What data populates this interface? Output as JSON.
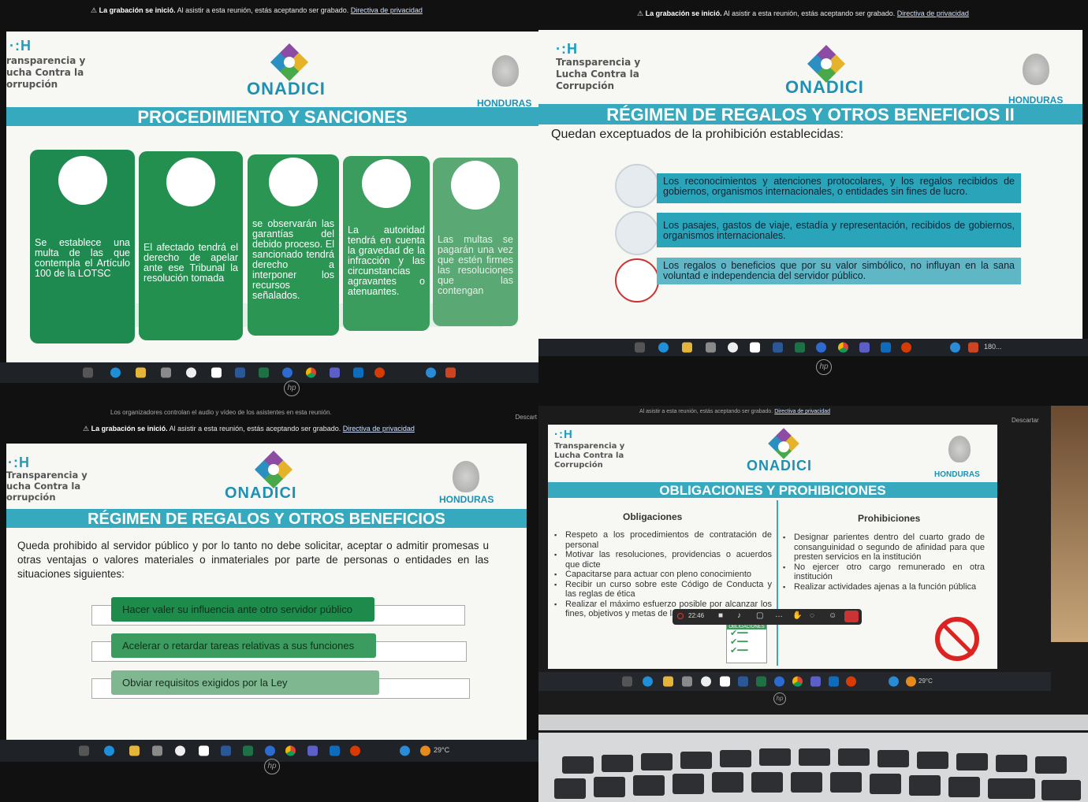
{
  "q1": {
    "banner_bold": "La grabación se inició.",
    "banner_text": "Al asistir a esta reunión, estás aceptando ser grabado.",
    "banner_link": "Directiva de privacidad",
    "org_lines": [
      "ransparencia y",
      "ucha Contra la",
      "orrupción"
    ],
    "brand": "ONADICI",
    "country": "HONDURAS",
    "title": "PROCEDIMIENTO Y SANCIONES",
    "cards": [
      "Se establece una multa de las que contempla el Artículo 100 de la LOTSC",
      "El afectado tendrá el derecho de apelar ante ese Tribunal la resolución tomada",
      "se observarán las garantías del debido proceso. El sancionado tendrá derecho a interponer los recursos señalados.",
      "La autoridad tendrá en cuenta la gravedad de la infracción y las circunstancias agravantes o atenuantes.",
      "Las multas se pagarán una vez que estén firmes las resoluciones que las contengan"
    ],
    "colors": {
      "card_dark": "#1f8a50",
      "card_light": "#5aa873",
      "title_bar": "#36a9be"
    }
  },
  "q2": {
    "banner_bold": "La grabación se inició.",
    "banner_text": "Al asistir a esta reunión, estás aceptando ser grabado.",
    "banner_link": "Directiva de privacidad",
    "org_lines": [
      "Transparencia y",
      "Lucha Contra la",
      "Corrupción"
    ],
    "brand": "ONADICI",
    "country": "HONDURAS",
    "title": "RÉGIMEN DE REGALOS Y OTROS BENEFICIOS II",
    "subtitle": "Quedan exceptuados de la prohibición establecidas:",
    "rows": [
      "Los reconocimientos y atenciones protocolares, y los regalos recibidos de gobiernos, organismos internacionales, o entidades sin fines de lucro.",
      "Los pasajes, gastos de viaje, estadía y representación, recibidos de gobiernos, organismos internacionales.",
      "Los regalos o beneficios que por su valor simbólico, no influyan en la sana voluntad e independencia del servidor público."
    ],
    "tray_text": "180..."
  },
  "q3": {
    "top_text": "Los organizadores controlan el audio y vídeo de los asistentes en esta reunión.",
    "right_text": "Descart",
    "banner_bold": "La grabación se inició.",
    "banner_text": "Al asistir a esta reunión, estás aceptando ser grabado.",
    "banner_link": "Directiva de privacidad",
    "org_lines": [
      "Transparencia y",
      "ucha Contra la",
      "orrupción"
    ],
    "brand": "ONADICI",
    "country": "HONDURAS",
    "title": "RÉGIMEN DE REGALOS Y OTROS BENEFICIOS",
    "intro": "Queda prohibido al servidor público y por lo tanto no debe solicitar, aceptar o admitir promesas u otras ventajas o valores materiales o inmateriales por parte de personas o entidades en las situaciones siguientes:",
    "items": [
      "Hacer valer su influencia ante otro servidor público",
      "Acelerar o retardar tareas relativas a sus funciones",
      "Obviar requisitos exigidos por la Ley"
    ],
    "weather": "29°C"
  },
  "q4": {
    "banner_text": "Al asistir a esta reunión, estás aceptando ser grabado.",
    "banner_link": "Directiva de privacidad",
    "right_text": "Descartar",
    "org_lines": [
      "Transparencia y",
      "Lucha Contra la",
      "Corrupción"
    ],
    "brand": "ONADICI",
    "country": "HONDURAS",
    "title": "OBLIGACIONES Y PROHIBICIONES",
    "col_left_title": "Obligaciones",
    "col_right_title": "Prohibiciones",
    "left_items": [
      "Respeto a los procedimientos de contratación de personal",
      "Motivar las resoluciones, providencias o acuerdos que dicte",
      "Capacitarse para actuar con pleno conocimiento",
      "Recibir un curso sobre este Código de Conducta y las reglas de ética",
      "Realizar el máximo esfuerzo posible por alcanzar los fines, objetivos y metas de la institución."
    ],
    "right_items": [
      "Designar parientes dentro del cuarto grado de consanguinidad o segundo de afinidad para que presten servicios en la institución",
      "No ejercer otro cargo remunerado en otra institución",
      "Realizar actividades ajenas a la función pública"
    ],
    "meeting_time": "22:46",
    "oblig_label": "OBLIGACIONES",
    "weather": "29°C"
  }
}
